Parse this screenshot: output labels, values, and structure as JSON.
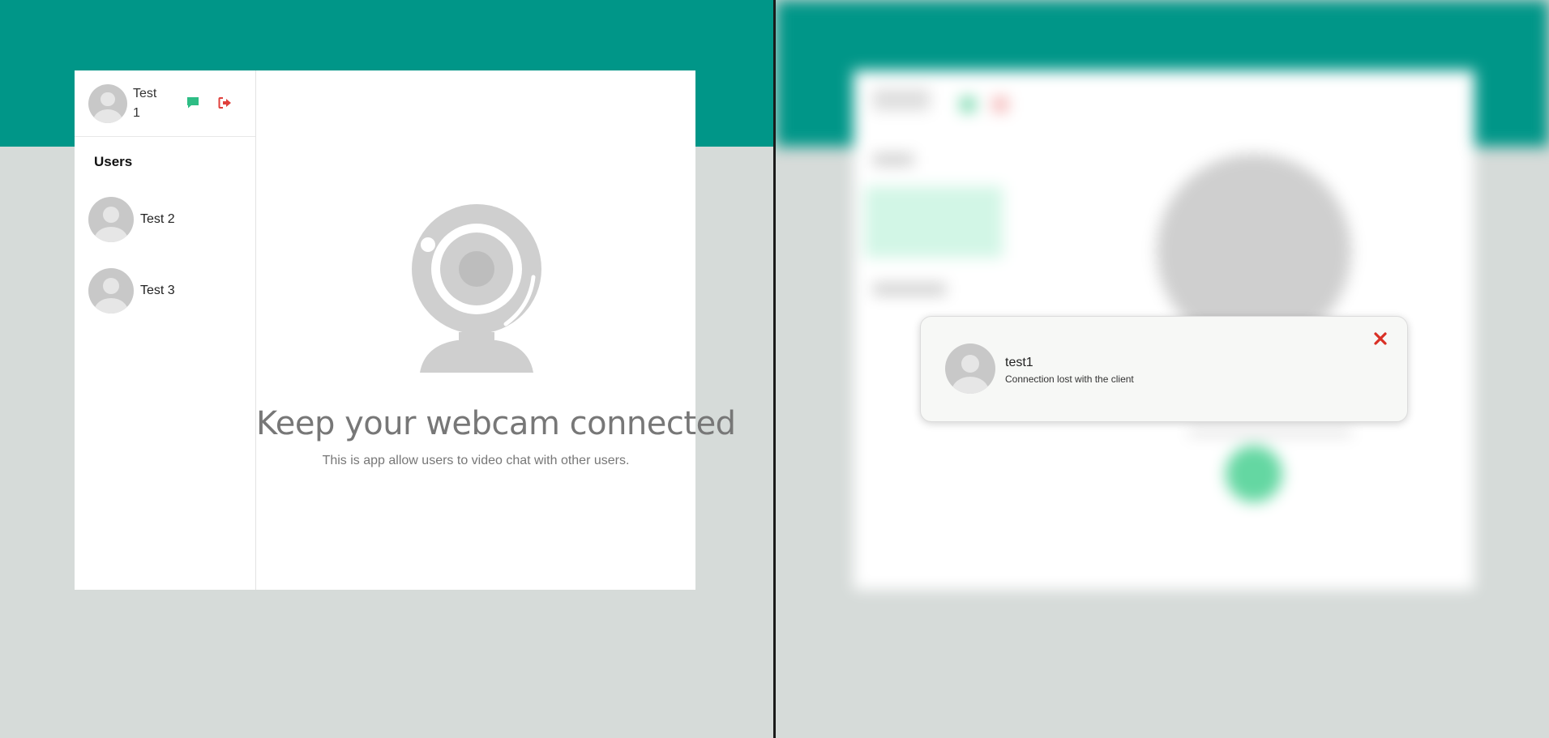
{
  "left_app": {
    "current_user": {
      "name": "Test 1"
    },
    "actions": [
      {
        "icon": "chat-bubble-icon",
        "color": "#2ebd85"
      },
      {
        "icon": "sign-out-icon",
        "color": "#e0403c"
      }
    ],
    "users_title": "Users",
    "users": [
      {
        "name": "Test 2"
      },
      {
        "name": "Test 3"
      }
    ],
    "empty_state": {
      "icon": "webcam-icon",
      "title": "Keep your webcam connected",
      "subtitle": "This is app allow users to video chat with other users."
    }
  },
  "notification": {
    "user": "test1",
    "message": "Connection lost with the client",
    "close_icon": "close-icon",
    "close_color": "#d93025"
  },
  "colors": {
    "brand_band": "#009688",
    "page_bg": "#d6dbd9",
    "accent_green": "#2ebd85",
    "danger_red": "#e0403c"
  }
}
